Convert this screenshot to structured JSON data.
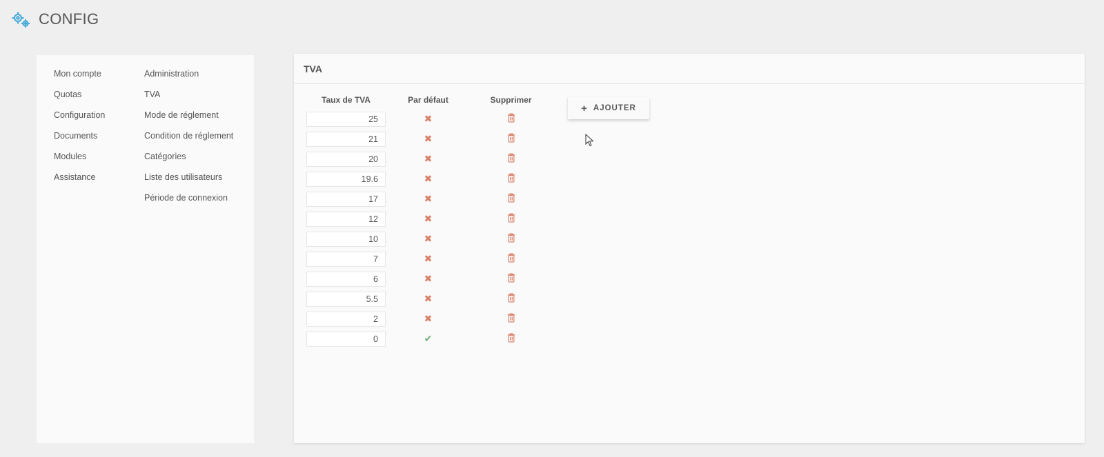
{
  "app": {
    "title": "CONFIG",
    "logo_icon": "gears-icon",
    "accent": "#3fa9d8"
  },
  "sidebar": {
    "col1": [
      {
        "label": "Mon compte"
      },
      {
        "label": "Quotas"
      },
      {
        "label": "Configuration"
      },
      {
        "label": "Documents"
      },
      {
        "label": "Modules"
      },
      {
        "label": "Assistance"
      }
    ],
    "col2": [
      {
        "label": "Administration"
      },
      {
        "label": "TVA"
      },
      {
        "label": "Mode de réglement"
      },
      {
        "label": "Condition de réglement"
      },
      {
        "label": "Catégories"
      },
      {
        "label": "Liste des utilisateurs"
      },
      {
        "label": "Période de connexion"
      }
    ]
  },
  "main": {
    "title": "TVA",
    "columns": {
      "rate": "Taux de TVA",
      "default": "Par défaut",
      "delete": "Supprimer"
    },
    "rows": [
      {
        "rate": "25",
        "default": false
      },
      {
        "rate": "21",
        "default": false
      },
      {
        "rate": "20",
        "default": false
      },
      {
        "rate": "19.6",
        "default": false
      },
      {
        "rate": "17",
        "default": false
      },
      {
        "rate": "12",
        "default": false
      },
      {
        "rate": "10",
        "default": false
      },
      {
        "rate": "7",
        "default": false
      },
      {
        "rate": "6",
        "default": false
      },
      {
        "rate": "5.5",
        "default": false
      },
      {
        "rate": "2",
        "default": false
      },
      {
        "rate": "0",
        "default": true
      }
    ],
    "add_button": {
      "label": "AJOUTER",
      "icon": "plus-icon"
    },
    "colors": {
      "x": "#d9826a",
      "check": "#6fb07a",
      "trash": "#d9826a"
    }
  }
}
